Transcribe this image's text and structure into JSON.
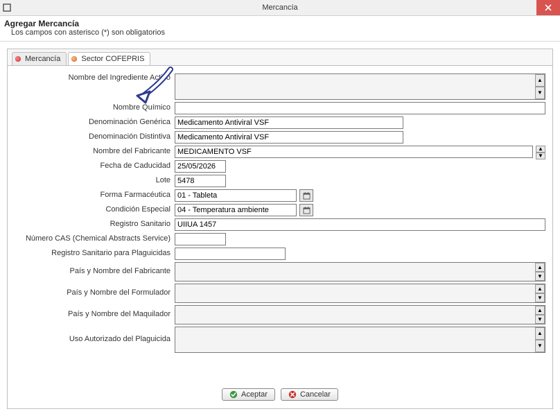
{
  "window": {
    "title": "Mercancía"
  },
  "header": {
    "title": "Agregar Mercancía",
    "subtitle": "Los campos con asterisco (*) son obligatorios"
  },
  "tabs": {
    "mercancia": "Mercancía",
    "sector_cofepris": "Sector COFEPRIS"
  },
  "labels": {
    "nombre_ingrediente_activo": "Nombre del Ingrediente Activo",
    "nombre_quimico": "Nombre Químico",
    "denominacion_generica": "Denominación Genérica",
    "denominacion_distintiva": "Denominación Distintiva",
    "nombre_fabricante": "Nombre del Fabricante",
    "fecha_caducidad": "Fecha de Caducidad",
    "lote": "Lote",
    "forma_farmaceutica": "Forma Farmacéutica",
    "condicion_especial": "Condición Especial",
    "registro_sanitario": "Registro Sanitario",
    "numero_cas": "Número CAS (Chemical Abstracts Service)",
    "registro_sanitario_plaguicidas": "Registro Sanitario para Plaguicidas",
    "pais_nombre_fabricante": "País y Nombre del Fabricante",
    "pais_nombre_formulador": "País y Nombre del Formulador",
    "pais_nombre_maquilador": "País y Nombre del Maquilador",
    "uso_autorizado_plaguicida": "Uso Autorizado del Plaguicida"
  },
  "values": {
    "nombre_ingrediente_activo": "",
    "nombre_quimico": "",
    "denominacion_generica": "Medicamento Antiviral VSF",
    "denominacion_distintiva": "Medicamento Antiviral VSF",
    "nombre_fabricante": "MEDICAMENTO VSF",
    "fecha_caducidad": "25/05/2026",
    "lote": "5478",
    "forma_farmaceutica": "01 - Tableta",
    "condicion_especial": "04 - Temperatura ambiente",
    "registro_sanitario": "UIIUA 1457",
    "numero_cas": "",
    "registro_sanitario_plaguicidas": "",
    "pais_nombre_fabricante": "",
    "pais_nombre_formulador": "",
    "pais_nombre_maquilador": "",
    "uso_autorizado_plaguicida": ""
  },
  "buttons": {
    "aceptar": "Aceptar",
    "cancelar": "Cancelar"
  }
}
